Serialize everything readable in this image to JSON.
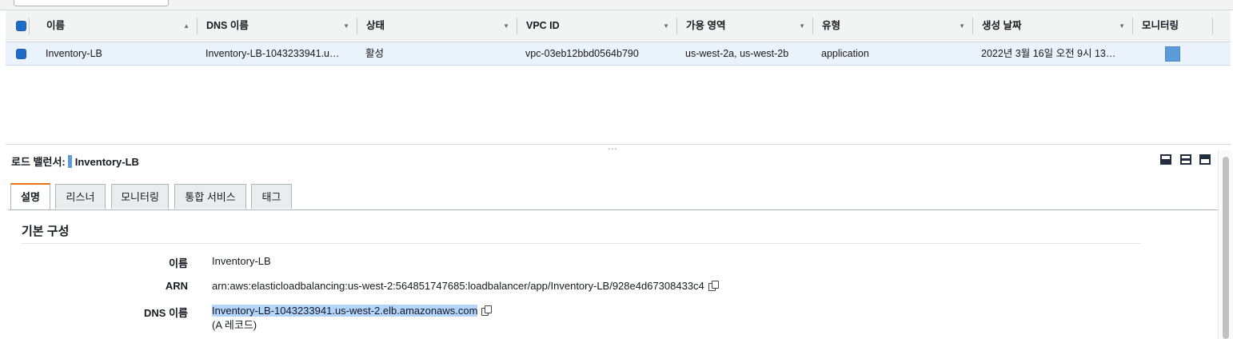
{
  "table": {
    "columns": [
      {
        "label": "이름",
        "sort": "▲"
      },
      {
        "label": "DNS 이름",
        "sort": "▼"
      },
      {
        "label": "상태",
        "sort": "▼"
      },
      {
        "label": "VPC ID",
        "sort": "▼"
      },
      {
        "label": "가용 영역",
        "sort": "▼"
      },
      {
        "label": "유형",
        "sort": "▼"
      },
      {
        "label": "생성 날짜",
        "sort": "▼"
      },
      {
        "label": "모니터링",
        "sort": ""
      }
    ],
    "rows": [
      {
        "name": "Inventory-LB",
        "dns": "Inventory-LB-1043233941.u…",
        "state": "활성",
        "vpc": "vpc-03eb12bbd0564b790",
        "az": "us-west-2a, us-west-2b",
        "type": "application",
        "created": "2022년 3월 16일 오전 9시 13…"
      }
    ]
  },
  "detail": {
    "title_prefix": "로드 밸런서:",
    "title_name": "Inventory-LB",
    "tabs": [
      "설명",
      "리스너",
      "모니터링",
      "통합 서비스",
      "태그"
    ],
    "active_tab": "설명",
    "section_title": "기본 구성",
    "fields": {
      "name_label": "이름",
      "name_value": "Inventory-LB",
      "arn_label": "ARN",
      "arn_value": "arn:aws:elasticloadbalancing:us-west-2:564851747685:loadbalancer/app/Inventory-LB/928e4d67308433c4",
      "dns_label": "DNS 이름",
      "dns_value": "Inventory-LB-1043233941.us-west-2.elb.amazonaws.com",
      "dns_note": "(A 레코드)"
    }
  },
  "colors": {
    "accent": "#ec7211",
    "selection": "#eaf2fc",
    "checkbox": "#1f6bc8",
    "highlight": "#b3d4fc"
  }
}
